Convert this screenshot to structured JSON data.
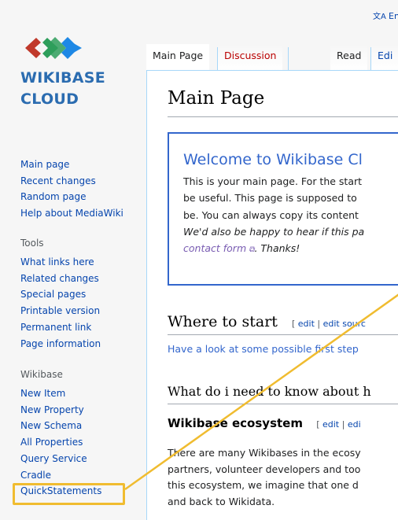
{
  "topbar": {
    "language": "Eng"
  },
  "logo": {
    "line1": "WIKIBASE",
    "line2": "CLOUD"
  },
  "nav": {
    "main": [
      "Main page",
      "Recent changes",
      "Random page",
      "Help about MediaWiki"
    ],
    "tools_heading": "Tools",
    "tools": [
      "What links here",
      "Related changes",
      "Special pages",
      "Printable version",
      "Permanent link",
      "Page information"
    ],
    "wikibase_heading": "Wikibase",
    "wikibase": [
      "New Item",
      "New Property",
      "New Schema",
      "All Properties",
      "Query Service",
      "Cradle",
      "QuickStatements"
    ]
  },
  "tabs": {
    "main_page": "Main Page",
    "discussion": "Discussion",
    "read": "Read",
    "edit": "Edi"
  },
  "page": {
    "title": "Main Page",
    "welcome": {
      "title": "Welcome to Wikibase Cl",
      "line1": "This is your main page. For the start",
      "line2": "be useful. This page is supposed to ",
      "line3": "be. You can always copy its content ",
      "line4": "We'd also be happy to hear if this pa",
      "line5_link": "contact form",
      "line5_rest": ". Thanks!"
    },
    "section1": {
      "title": "Where to start",
      "edit": "edit",
      "edit_source": "edit sourc",
      "text": "Have a look at some possible first step"
    },
    "section2": {
      "title": "What do i need to know about h"
    },
    "section3": {
      "title": "Wikibase ecosystem",
      "edit": "edit",
      "edit_source": "edi",
      "lines": [
        "There are many Wikibases in the ecosy",
        "partners, volunteer developers and too",
        "this ecosystem, we imagine that one d",
        "and back to Wikidata."
      ]
    }
  },
  "colors": {
    "link": "#0645ad",
    "accent": "#3366cc",
    "highlight": "#f0bc30",
    "logo_blue": "#2b6cb0",
    "logo_green": "#2e9e5b",
    "logo_red": "#c0392b"
  }
}
